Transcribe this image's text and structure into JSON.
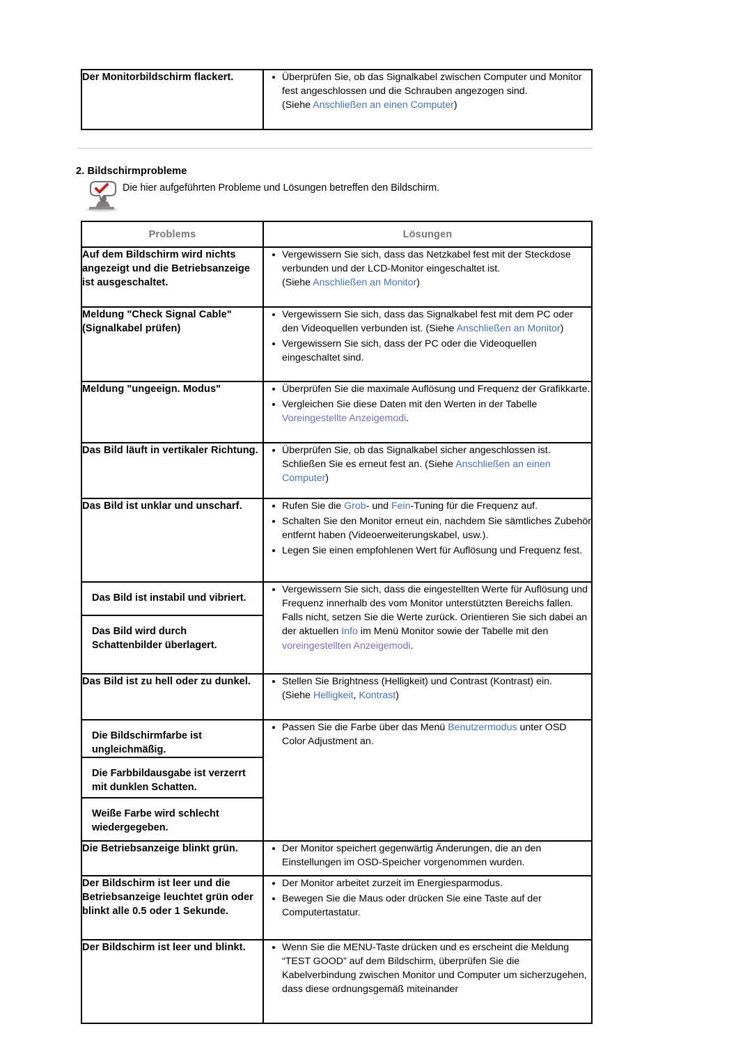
{
  "document": {
    "section_number_title": "2. Bildschirmprobleme",
    "section_note": "Die hier aufgeführten Probleme und Lösungen betreffen den Bildschirm.",
    "note_icon": "checkmark-speech-bubble-icon"
  },
  "colors": {
    "link": "#4472b8",
    "visited_link": "#6f6fc4",
    "header_text": "#777674",
    "rule": "#e2e0de"
  },
  "top_table": {
    "problem": "Der Monitorbildschirm flackert.",
    "solution": {
      "bullet_1_a": "Überprüfen Sie, ob das Signalkabel zwischen Computer und Monitor fest angeschlossen und die Schrauben angezogen sind.",
      "bullet_1_b_pre": "(Siehe ",
      "bullet_1_b_link": "Anschließen an einen Computer",
      "bullet_1_b_post": ")"
    }
  },
  "main_table": {
    "header": {
      "col1": "Problems",
      "col2": "Lösungen"
    },
    "rows": [
      {
        "problem": "Auf dem Bildschirm wird nichts angezeigt und die Betriebsanzeige ist ausgeschaltet.",
        "s1": "Vergewissern Sie sich, dass das Netzkabel fest mit der Steckdose verbunden und der LCD-Monitor eingeschaltet ist.",
        "s1_line2_pre": "(Siehe ",
        "s1_line2_link": "Anschließen an Monitor",
        "s1_line2_post": ")"
      },
      {
        "problem": "Meldung \"Check Signal Cable\" (Signalkabel prüfen)",
        "s1_pre": "Vergewissern Sie sich, dass das Signalkabel fest mit dem PC oder den Videoquellen verbunden ist. (Siehe ",
        "s1_link": "Anschließen an Monitor",
        "s1_post": ")",
        "s2": "Vergewissern Sie sich, dass der PC oder die Videoquellen eingeschaltet sind."
      },
      {
        "problem": "Meldung \"ungeeign. Modus\"",
        "s1": "Überprüfen Sie die maximale Auflösung und Frequenz der Grafikkarte.",
        "s2_pre": "Vergleichen Sie diese Daten mit den Werten in der Tabelle ",
        "s2_link": "Voreingestellte Anzeigemodi",
        "s2_post": "."
      },
      {
        "problem": "Das Bild läuft in vertikaler Richtung.",
        "s1_pre": "Überprüfen Sie, ob das Signalkabel sicher angeschlossen ist. Schließen Sie es erneut fest an. (Siehe ",
        "s1_link": "Anschließen an einen Computer",
        "s1_post": ")"
      },
      {
        "problem": "Das Bild ist unklar und unscharf.",
        "s1_a": "Rufen Sie die ",
        "s1_link1": "Grob",
        "s1_b": "- und ",
        "s1_link2": "Fein",
        "s1_c": "-Tuning für die Frequenz auf.",
        "s2": "Schalten Sie den Monitor erneut ein, nachdem Sie sämtliches Zubehör entfernt haben (Videoerweiterungskabel, usw.).",
        "s3": "Legen Sie einen empfohlenen Wert für Auflösung und Frequenz fest."
      },
      {
        "problems": [
          "Das Bild ist instabil und vibriert.",
          "Das Bild wird durch Schattenbilder überlagert."
        ],
        "s1_a": "Vergewissern Sie sich, dass die eingestellten Werte für Auflösung und Frequenz innerhalb des vom Monitor unterstützten Bereichs fallen. Falls nicht, setzen Sie die Werte zurück. Orientieren Sie sich dabei an der aktuellen ",
        "s1_link1": "Info",
        "s1_b": " im Menü Monitor sowie der Tabelle mit den ",
        "s1_link2": "voreingestellten Anzeigemodi",
        "s1_c": "."
      },
      {
        "problem": "Das Bild ist zu hell oder zu dunkel.",
        "s1": "Stellen Sie Brightness (Helligkeit) und Contrast (Kontrast) ein.",
        "s1_line2_pre": "(Siehe ",
        "s1_line2_link1": "Helligkeit",
        "s1_line2_mid": ", ",
        "s1_line2_link2": "Kontrast",
        "s1_line2_post": ")"
      },
      {
        "problems": [
          "Die Bildschirmfarbe ist ungleichmäßig.",
          "Die Farbbildausgabe ist verzerrt mit dunklen Schatten.",
          "Weiße Farbe wird schlecht wiedergegeben."
        ],
        "s1_a": "Passen Sie die Farbe über das Menü ",
        "s1_link": "Benutzermodus",
        "s1_b": " unter OSD Color Adjustment an."
      },
      {
        "problem": "Die Betriebsanzeige blinkt grün.",
        "s1": "Der Monitor speichert gegenwärtig Änderungen, die an den Einstellungen im OSD-Speicher vorgenommen wurden."
      },
      {
        "problem": "Der Bildschirm ist leer und die Betriebsanzeige leuchtet grün oder blinkt alle 0.5 oder 1 Sekunde.",
        "s1": "Der Monitor arbeitet zurzeit im Energiesparmodus.",
        "s2": "Bewegen Sie die Maus oder drücken Sie eine Taste auf der Computertastatur."
      },
      {
        "problem": "Der Bildschirm ist leer und blinkt.",
        "s1": "Wenn Sie die MENU-Taste drücken und es erscheint die Meldung “TEST GOOD” auf dem Bildschirm, überprüfen Sie die Kabelverbindung zwischen Monitor und Computer um sicherzugehen, dass diese ordnungsgemäß miteinander"
      }
    ]
  }
}
